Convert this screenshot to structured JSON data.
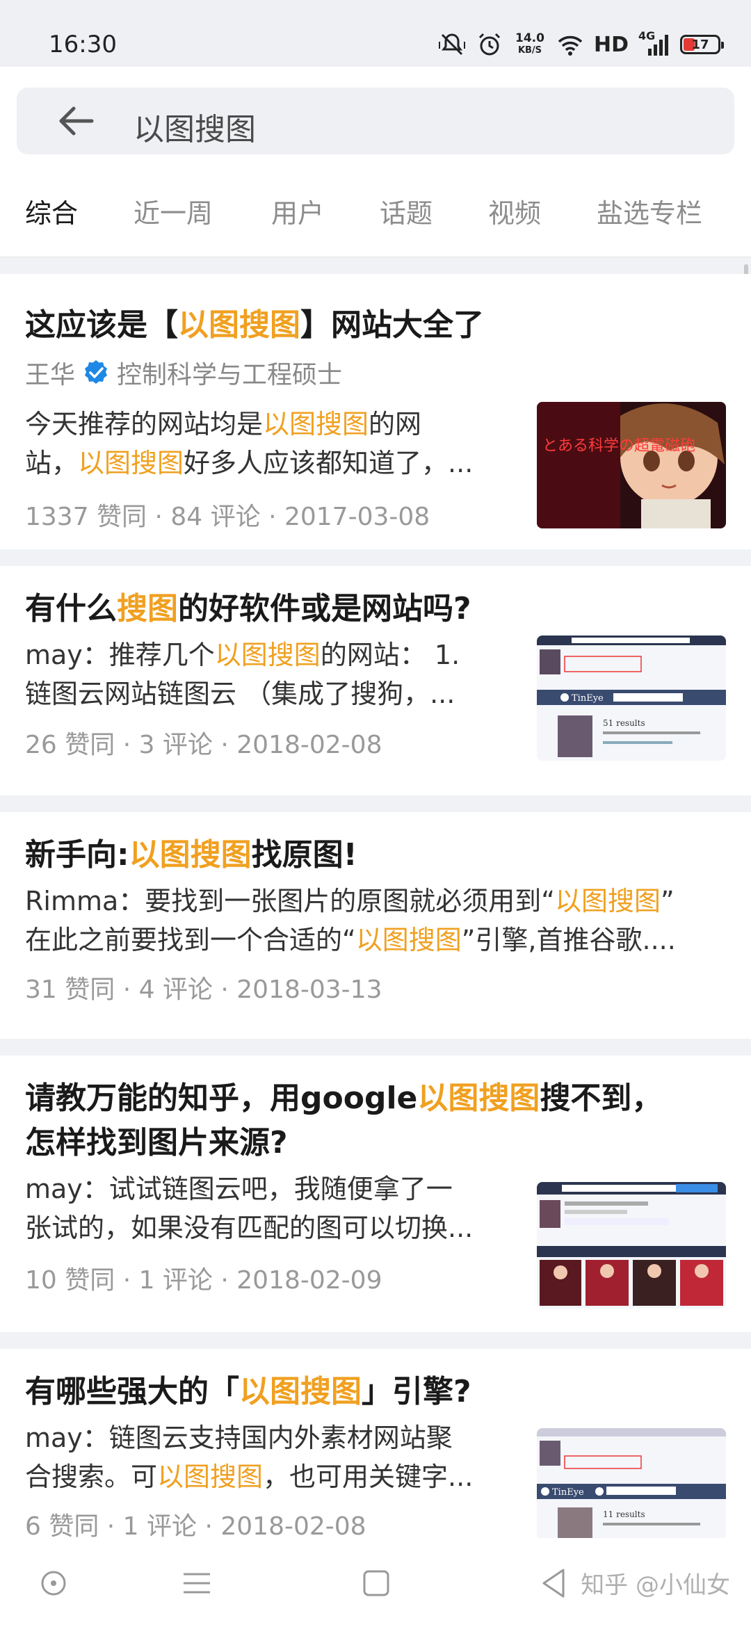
{
  "status_bar": {
    "time": "16:30",
    "net_speed_value": "14.0",
    "net_speed_unit": "KB/S",
    "hd_label": "HD",
    "network_label": "4G",
    "battery_level": "17"
  },
  "search": {
    "query": "以图搜图"
  },
  "tabs": [
    {
      "label": "综合",
      "active": true
    },
    {
      "label": "近一周",
      "active": false
    },
    {
      "label": "用户",
      "active": false
    },
    {
      "label": "话题",
      "active": false
    },
    {
      "label": "视频",
      "active": false
    },
    {
      "label": "盐选专栏",
      "active": false
    }
  ],
  "results": [
    {
      "title_parts": [
        "这应该是【",
        "以图搜图",
        "】网站大全了"
      ],
      "author_name": "王华",
      "author_desc": "控制科学与工程硕士",
      "excerpt_line1": [
        "今天推荐的网站均是",
        "以图搜图",
        "的网"
      ],
      "excerpt_line2": [
        "站，",
        "以图搜图",
        "好多人应该都知道了，..."
      ],
      "meta": "1337 赞同 · 84 评论 · 2017-03-08",
      "thumb_text": "とある科学の超電磁砲"
    },
    {
      "title_parts": [
        "有什么",
        "搜图",
        "的好软件或是网站吗?"
      ],
      "excerpt_line1": [
        "may：推荐几个",
        "以图搜图",
        "的网站： 1."
      ],
      "excerpt_line2": [
        "链图云网站链图云 （集成了搜狗，",
        "",
        "..."
      ],
      "meta": "26 赞同 · 3 评论 · 2018-02-08",
      "thumb_brand": "TinEye",
      "thumb_results": "51 results"
    },
    {
      "title_parts": [
        "新手向:",
        "以图搜图",
        "找原图!"
      ],
      "excerpt_line1": [
        "Rimma：要找到一张图片的原图就必须用到“",
        "以图搜图",
        "”"
      ],
      "excerpt_line2": [
        "在此之前要找到一个合适的“",
        "以图搜图",
        "”引擎,首推谷歌...."
      ],
      "meta": "31 赞同 · 4 评论 · 2018-03-13"
    },
    {
      "title_line1": [
        "请教万能的知乎，用google",
        "以图搜图",
        "搜不到，"
      ],
      "title_line2": "怎样找到图片来源?",
      "excerpt_line1": [
        "may：试试链图云吧，我随便拿了一",
        "",
        ""
      ],
      "excerpt_line2": [
        "张试的，如果没有匹配的图可以切换...",
        "",
        ""
      ],
      "meta": "10 赞同 · 1 评论 · 2018-02-09"
    },
    {
      "title_parts": [
        "有哪些强大的「",
        "以图搜图",
        "」引擎?"
      ],
      "excerpt_line1": [
        "may：链图云支持国内外素材网站聚",
        "",
        ""
      ],
      "excerpt_line2": [
        "合搜索。可",
        "以图搜图",
        "，也可用关键字..."
      ],
      "meta": "6 赞同 · 1 评论 · 2018-02-08",
      "thumb_brand": "TinEye",
      "thumb_results": "11 results"
    }
  ],
  "watermark": "知乎 @小仙女",
  "colors": {
    "highlight": "#f0a020",
    "verified": "#1e88e5",
    "battery_low": "#e53935"
  }
}
